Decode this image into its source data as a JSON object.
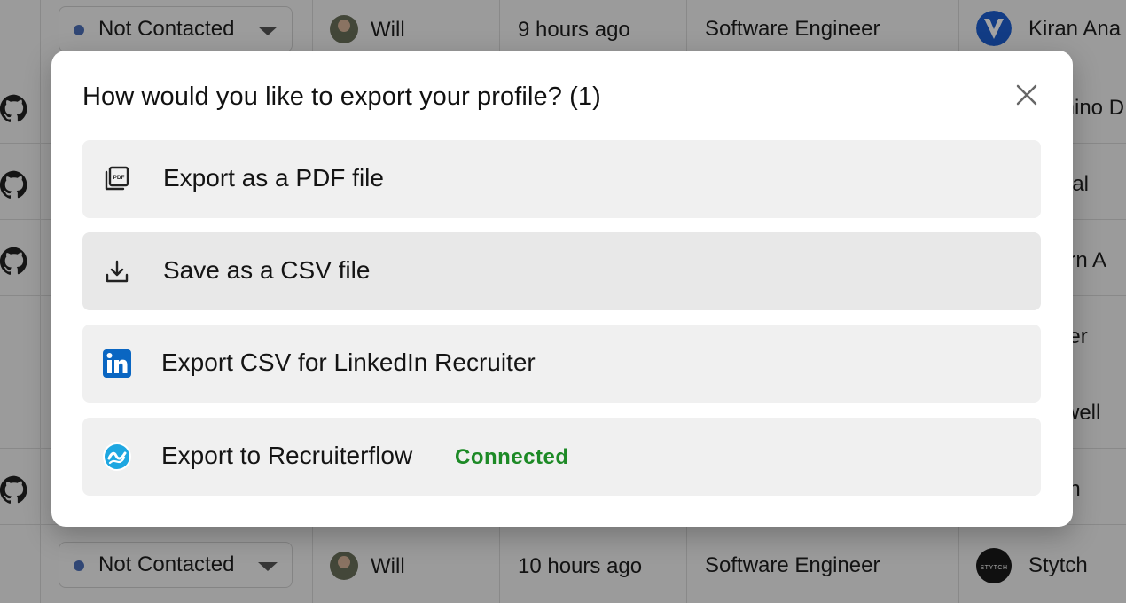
{
  "background_table": {
    "rows": [
      {
        "status": "Not Contacted",
        "owner": "Will",
        "time": "9 hours ago",
        "role": "Software Engineer",
        "company": "Kiran Ana"
      },
      {
        "company_fragment": "mino D"
      },
      {
        "company_fragment": "ical"
      },
      {
        "company_fragment": "ern A"
      },
      {
        "company_fragment": "der"
      },
      {
        "company_fragment": "rwell"
      },
      {
        "company_fragment": "on"
      },
      {
        "status": "Not Contacted",
        "owner": "Will",
        "time": "10 hours ago",
        "role": "Software Engineer",
        "company": "Stytch",
        "company_logo_text": "STYTCH"
      }
    ]
  },
  "modal": {
    "title": "How would you like to export your profile? (1)",
    "options": [
      {
        "label": "Export as a PDF file",
        "icon": "pdf-icon"
      },
      {
        "label": "Save as a CSV file",
        "icon": "download-icon"
      },
      {
        "label": "Export CSV for LinkedIn Recruiter",
        "icon": "linkedin-icon"
      },
      {
        "label": "Export to Recruiterflow",
        "icon": "recruiterflow-icon",
        "badge": "Connected"
      }
    ]
  },
  "colors": {
    "linkedin": "#0a66c2",
    "connected": "#1d8a26",
    "recruiterflow": "#1ea7e1"
  }
}
